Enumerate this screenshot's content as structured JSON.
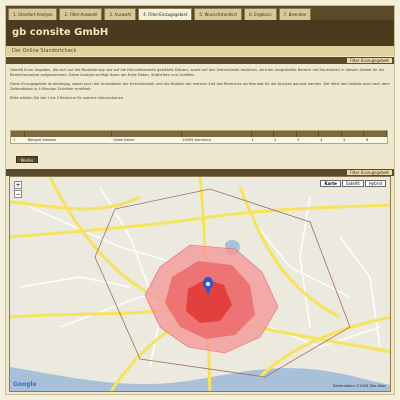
{
  "tabs": [
    {
      "label": "1. Standort-Analyse",
      "active": false
    },
    {
      "label": "2. Filter-Auswahl",
      "active": false
    },
    {
      "label": "3. Auswahl",
      "active": false
    },
    {
      "label": "4. Filter-Einzugsgebiet",
      "active": true
    },
    {
      "label": "5. Wunschstandort",
      "active": false
    },
    {
      "label": "6. Ergebnis",
      "active": false
    },
    {
      "label": "7. Beenden",
      "active": false
    }
  ],
  "header": {
    "brand": "gb consite GmbH",
    "tagline": "Der Online Standortcheck"
  },
  "section_top": {
    "tag": "Filter Einzugsgebiet"
  },
  "section_map": {
    "tag": "Filter Einzugsgebiet"
  },
  "content": {
    "p1": "Gemäß Ihren Angaben, die sich auf die Modellierung und auf die Fahrzeitbasierte gewählte Distanz, sowie auf den Zeitmaßstab beziehen, wird der dargestellte Bereich mit Haushalten in diesem Gebiet für die Bereichsanalyse aufgenommen. Diese Analyse schlägt Ihnen am Ende Daten, Statistiken und Grafiken",
    "p2": "Diese Einzugsgebiet ist abhängig, wobei auch die Grenzdaten der Erreichbarkeit und die Modelle der meisten Zeit des Bereiches als Resultat für die Analyse genutzt werden. Der Wert des Gebiets wird nach dem Zeitmaßstab in 5 Minuten Schritten ermittelt.",
    "p3": "Bitte wählen Sie die 1 bis 3 Bereiche für weitere Informationen."
  },
  "table": {
    "row": [
      "1",
      "Beispiel Adresse",
      "Grote Kaiser",
      "20095 Hamburg",
      "1",
      "2",
      "3",
      "4",
      "5",
      "6"
    ]
  },
  "button": {
    "label": "Weiter"
  },
  "map": {
    "controls": [
      {
        "label": "Karte",
        "selected": true
      },
      {
        "label": "Satellit",
        "selected": false
      },
      {
        "label": "Hybrid",
        "selected": false
      }
    ],
    "zoom_in": "+",
    "zoom_out": "−",
    "logo": "Google",
    "copyright": "Kartendaten ©2008 Tele Atlas",
    "colors": {
      "land": "#ece9df",
      "water": "#a9c0da",
      "road_major": "#f5e35c",
      "road_minor": "#ffffff",
      "zone_outer": "#f39a9a",
      "zone_mid": "#ec6666",
      "zone_inner": "#e23636",
      "marker": "#2a55d8"
    }
  }
}
